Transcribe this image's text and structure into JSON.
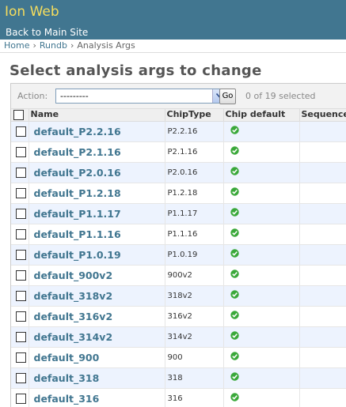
{
  "header": {
    "brand": "Ion Web",
    "back_link": "Back to Main Site",
    "background_color": "#417690",
    "brand_color": "#f5dd5d"
  },
  "breadcrumbs": {
    "items": [
      "Home",
      "Rundb",
      "Analysis Args"
    ],
    "separator": "›"
  },
  "page_title": "Select analysis args to change",
  "actions": {
    "label": "Action:",
    "selected_value": "---------",
    "go_label": "Go",
    "counter": "0 of 19 selected"
  },
  "table": {
    "columns": [
      "Name",
      "ChipType",
      "Chip default",
      "Sequence"
    ],
    "rows": [
      {
        "name": "default_P2.2.16",
        "chiptype": "P2.2.16",
        "chip_default": "check-icon"
      },
      {
        "name": "default_P2.1.16",
        "chiptype": "P2.1.16",
        "chip_default": "check-icon"
      },
      {
        "name": "default_P2.0.16",
        "chiptype": "P2.0.16",
        "chip_default": "check-icon"
      },
      {
        "name": "default_P1.2.18",
        "chiptype": "P1.2.18",
        "chip_default": "check-icon"
      },
      {
        "name": "default_P1.1.17",
        "chiptype": "P1.1.17",
        "chip_default": "check-icon"
      },
      {
        "name": "default_P1.1.16",
        "chiptype": "P1.1.16",
        "chip_default": "check-icon"
      },
      {
        "name": "default_P1.0.19",
        "chiptype": "P1.0.19",
        "chip_default": "check-icon"
      },
      {
        "name": "default_900v2",
        "chiptype": "900v2",
        "chip_default": "check-icon"
      },
      {
        "name": "default_318v2",
        "chiptype": "318v2",
        "chip_default": "check-icon"
      },
      {
        "name": "default_316v2",
        "chiptype": "316v2",
        "chip_default": "check-icon"
      },
      {
        "name": "default_314v2",
        "chiptype": "314v2",
        "chip_default": "check-icon"
      },
      {
        "name": "default_900",
        "chiptype": "900",
        "chip_default": "check-icon"
      },
      {
        "name": "default_318",
        "chiptype": "318",
        "chip_default": "check-icon"
      },
      {
        "name": "default_316",
        "chiptype": "316",
        "chip_default": "check-icon"
      }
    ]
  },
  "colors": {
    "link": "#417690",
    "row_alt": "#edf3fe",
    "check_green": "#3aa83a"
  }
}
